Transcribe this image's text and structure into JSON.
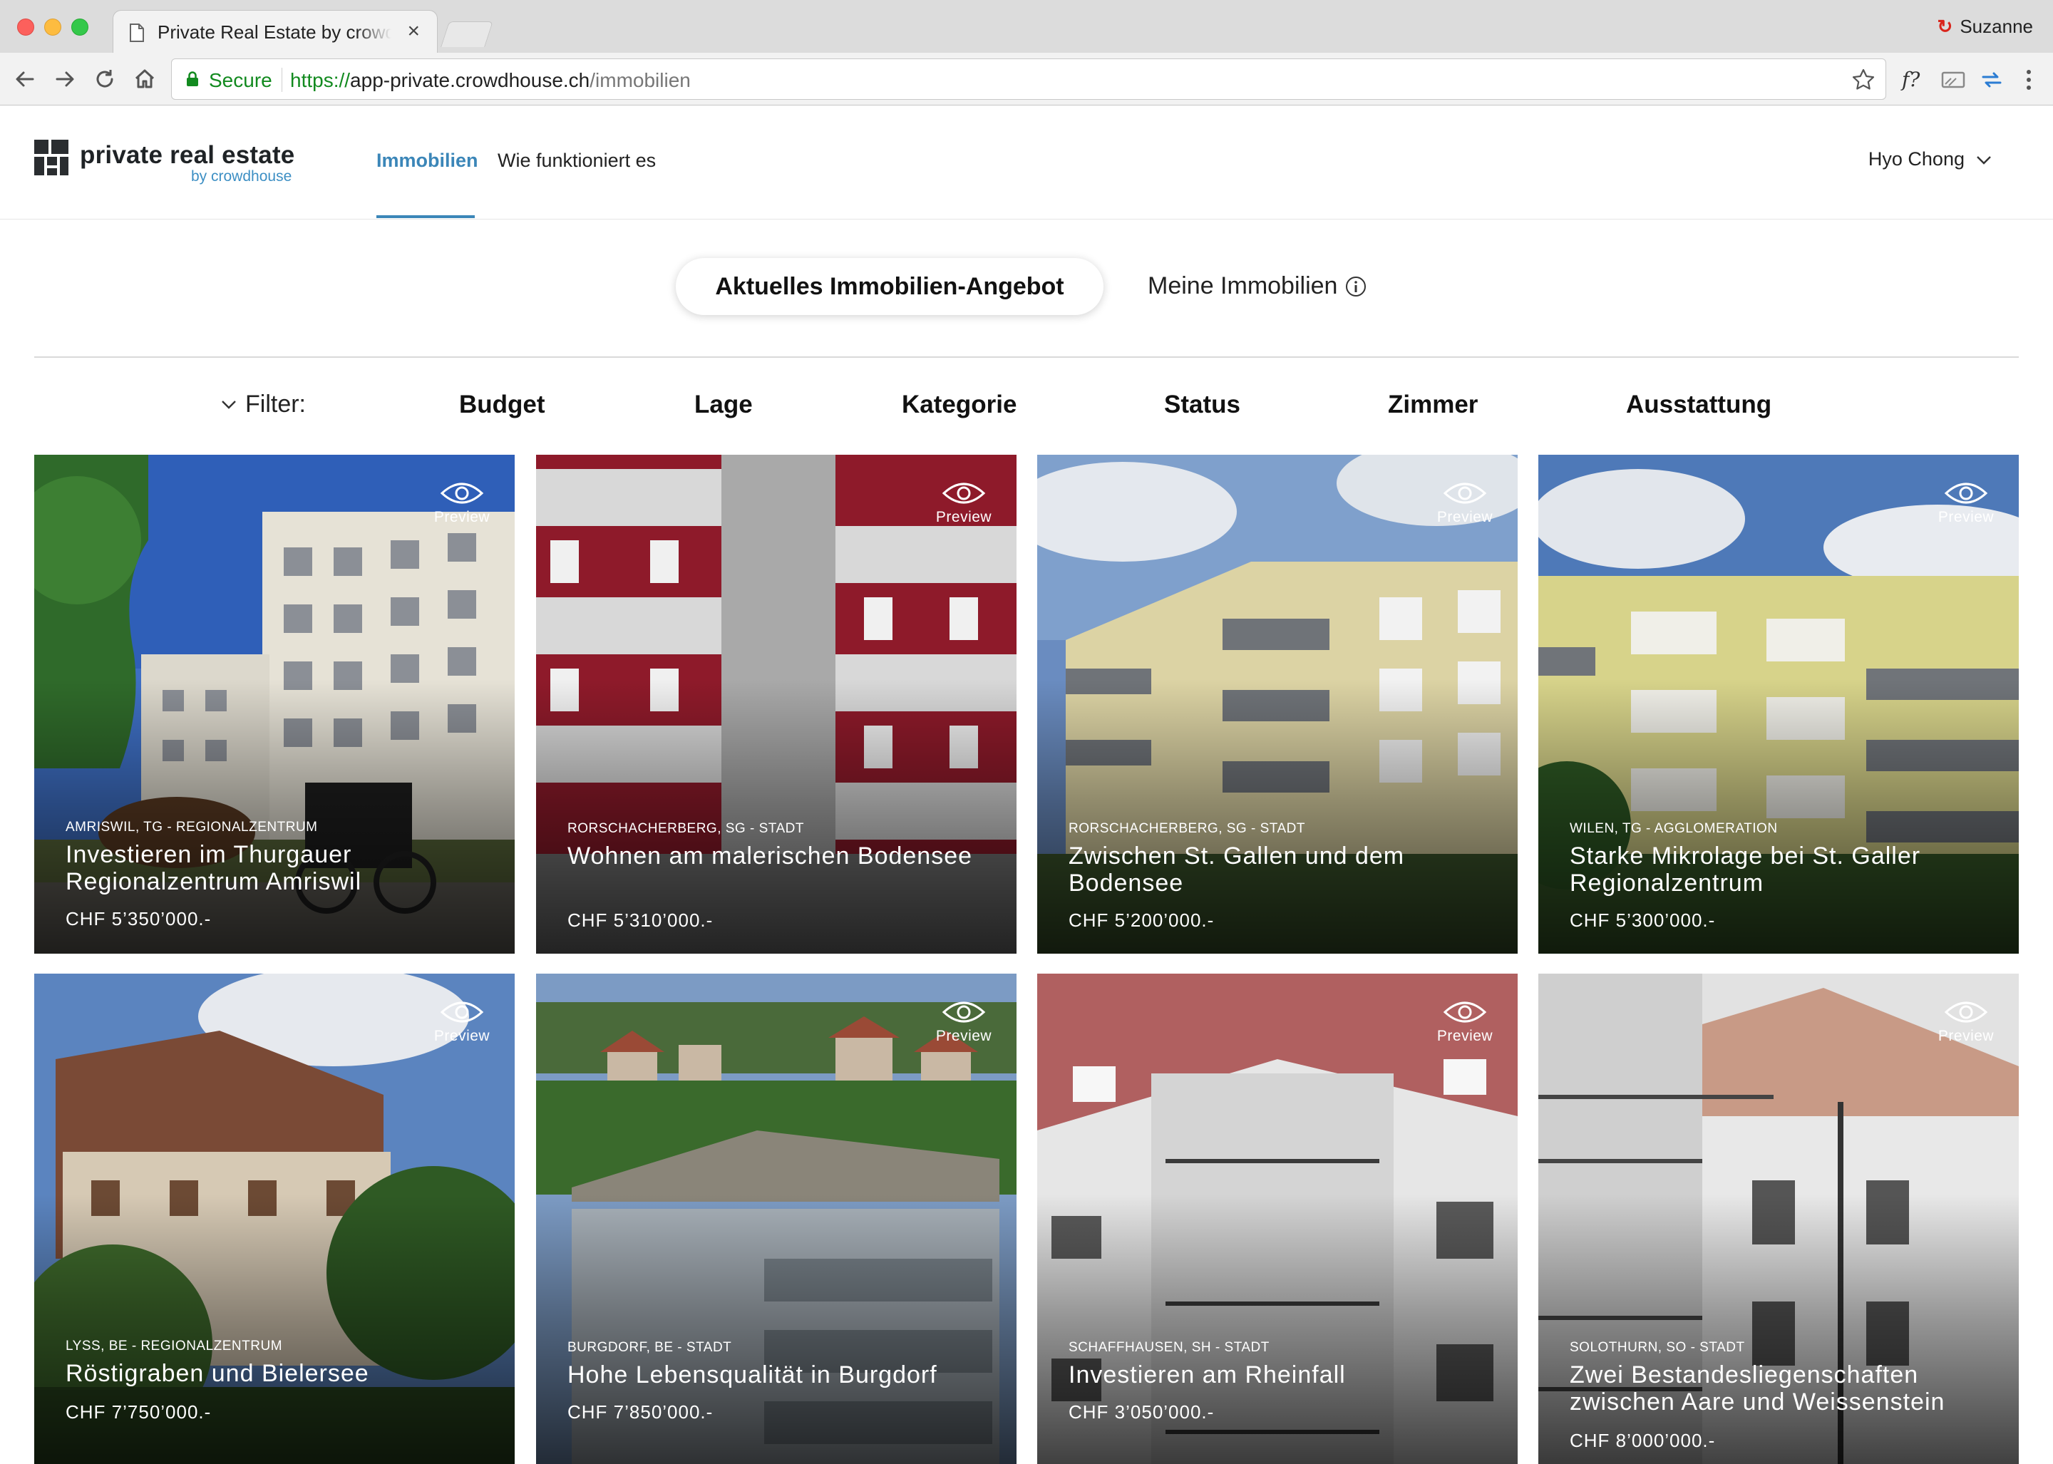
{
  "browser": {
    "tab_title": "Private Real Estate by crowdhouse",
    "tab_close": "×",
    "profile_name": "Suzanne",
    "secure_label": "Secure",
    "url_scheme": "https://",
    "url_host": "app-private.crowdhouse.ch",
    "url_path": "/immobilien"
  },
  "header": {
    "logo_main": "private real estate",
    "logo_sub": "by crowdhouse",
    "nav": [
      "Immobilien",
      "Wie funktioniert es"
    ],
    "user": "Hyo Chong"
  },
  "segments": {
    "active": "Aktuelles Immobilien-Angebot",
    "inactive": "Meine Immobilien"
  },
  "filters": {
    "label": "Filter:",
    "items": [
      "Budget",
      "Lage",
      "Kategorie",
      "Status",
      "Zimmer",
      "Ausstattung"
    ]
  },
  "preview_label": "Preview",
  "cards": [
    {
      "location": "Amriswil, TG - Regionalzentrum",
      "title": "Investieren im Thurgauer Regionalzentrum Amriswil",
      "price": "CHF 5’350’000.-"
    },
    {
      "location": "Rorschacherberg, SG - Stadt",
      "title": "Wohnen am malerischen Bodensee",
      "price": "CHF 5’310’000.-"
    },
    {
      "location": "Rorschacherberg, SG - Stadt",
      "title": "Zwischen St. Gallen und dem Bodensee",
      "price": "CHF 5’200’000.-"
    },
    {
      "location": "Wilen, TG - Agglomeration",
      "title": "Starke Mikrolage bei St. Galler Regionalzentrum",
      "price": "CHF 5’300’000.-"
    },
    {
      "location": "Lyss, BE - Regionalzentrum",
      "title": "Röstigraben und Bielersee",
      "price": "CHF 7’750’000.-"
    },
    {
      "location": "Burgdorf, BE - Stadt",
      "title": "Hohe Lebensqualität in Burgdorf",
      "price": "CHF 7’850’000.-"
    },
    {
      "location": "Schaffhausen, SH - Stadt",
      "title": "Investieren am Rheinfall",
      "price": "CHF 3’050’000.-"
    },
    {
      "location": "Solothurn, SO - Stadt",
      "title": "Zwei Bestandesliegenschaften zwischen Aare und Weissenstein",
      "price": "CHF 8’000’000.-"
    }
  ],
  "icons": {
    "tab": "document-icon",
    "nav": [
      "back-icon",
      "forward-icon",
      "reload-icon",
      "home-icon"
    ],
    "lock": "lock-icon",
    "star": "star-icon",
    "extensions": [
      "formula-extension-icon",
      "cast-icon",
      "sync-extension-icon",
      "menu-icon"
    ],
    "info": "info-icon",
    "preview": "eye-icon"
  },
  "colors": {
    "accent": "#3b86b8",
    "secure": "#128a1f"
  }
}
